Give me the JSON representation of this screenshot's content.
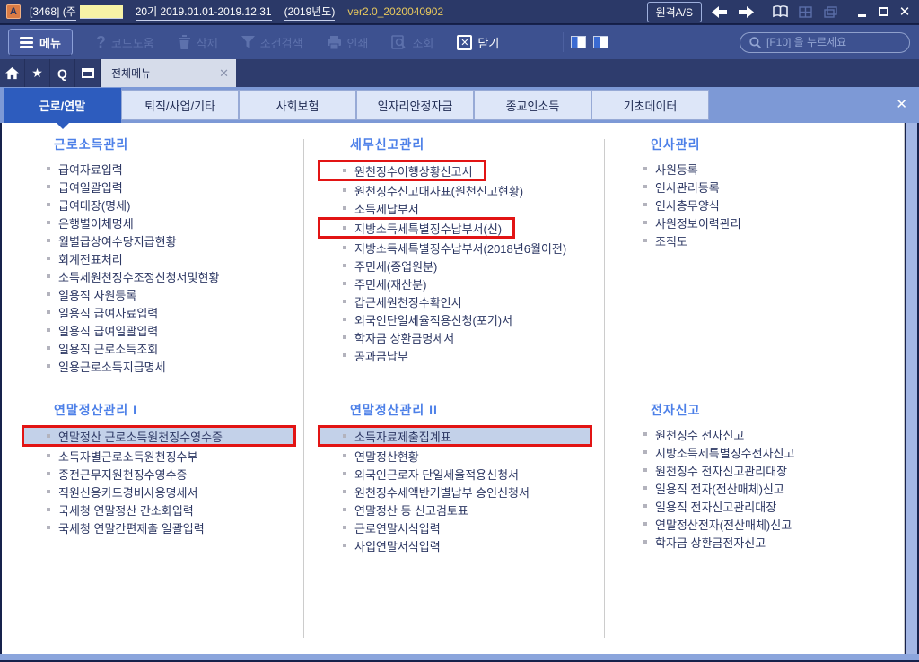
{
  "titlebar": {
    "app_icon": "A",
    "company_prefix": "[3468]  (주",
    "period": "20기  2019.01.01-2019.12.31",
    "year": "(2019년도)",
    "version": "ver2.0_2020040902",
    "remote_button": "원격A/S"
  },
  "toolbar": {
    "menu": "메뉴",
    "code_help": "코드도움",
    "delete": "삭제",
    "cond_search": "조건검색",
    "print": "인쇄",
    "inquiry": "조회",
    "close": "닫기",
    "search_placeholder": "[F10] 을 누르세요"
  },
  "tabstrip": {
    "active_tab": "전체메뉴",
    "icons": [
      "home-icon",
      "star-icon",
      "q-icon",
      "calendar-icon"
    ]
  },
  "category_tabs": {
    "selected": "근로/연말",
    "items": [
      {
        "label": "근로/연말"
      },
      {
        "label": "퇴직/사업/기타"
      },
      {
        "label": "사회보험"
      },
      {
        "label": "일자리안정자금"
      },
      {
        "label": "종교인소득"
      },
      {
        "label": "기초데이터"
      }
    ]
  },
  "accents": {
    "highlight_row_bg": "#c3d1e9",
    "callout_red": "#e21414",
    "selected_tab_blue": "#2d5cbe",
    "section_title_blue": "#4d80e8"
  },
  "sections": [
    {
      "title": "근로소득관리",
      "items": [
        "급여자료입력",
        "급여일괄입력",
        "급여대장(명세)",
        "은행별이체명세",
        "월별급상여수당지급현황",
        "회계전표처리",
        "소득세원천징수조정신청서및현황",
        "일용직 사원등록",
        "일용직 급여자료입력",
        "일용직 급여일괄입력",
        "일용직 근로소득조회",
        "일용근로소득지급명세"
      ]
    },
    {
      "title": "세무신고관리",
      "items": [
        {
          "label": "원천징수이행상황신고서",
          "redbox": true
        },
        "원천징수신고대사표(원천신고현황)",
        "소득세납부서",
        {
          "label": "지방소득세특별징수납부서(신)",
          "redbox": true
        },
        "지방소득세특별징수납부서(2018년6월이전)",
        "주민세(종업원분)",
        "주민세(재산분)",
        "갑근세원천징수확인서",
        "외국인단일세율적용신청(포기)서",
        "학자금 상환금명세서",
        "공과금납부"
      ]
    },
    {
      "title": "인사관리",
      "items": [
        "사원등록",
        "인사관리등록",
        "인사총무양식",
        "사원정보이력관리",
        "조직도"
      ]
    },
    {
      "title": "연말정산관리  I",
      "items": [
        {
          "label": "연말정산 근로소득원천징수영수증",
          "redbox": true,
          "highlight": true
        },
        "소득자별근로소득원천징수부",
        "종전근무지원천징수영수증",
        "직원신용카드경비사용명세서",
        "국세청 연말정산 간소화입력",
        "국세청 연말간편제출 일괄입력"
      ]
    },
    {
      "title": "연말정산관리  II",
      "items": [
        {
          "label": "소득자료제출집계표",
          "redbox": true,
          "highlight": true
        },
        "연말정산현황",
        "외국인근로자 단일세율적용신청서",
        "원천징수세액반기별납부 승인신청서",
        "연말정산 등 신고검토표",
        "근로연말서식입력",
        "사업연말서식입력"
      ]
    },
    {
      "title": "전자신고",
      "items": [
        "원천징수 전자신고",
        "지방소득세특별징수전자신고",
        "원천징수 전자신고관리대장",
        "일용직 전자(전산매체)신고",
        "일용직 전자신고관리대장",
        "연말정산전자(전산매체)신고",
        "학자금 상환금전자신고"
      ]
    }
  ]
}
